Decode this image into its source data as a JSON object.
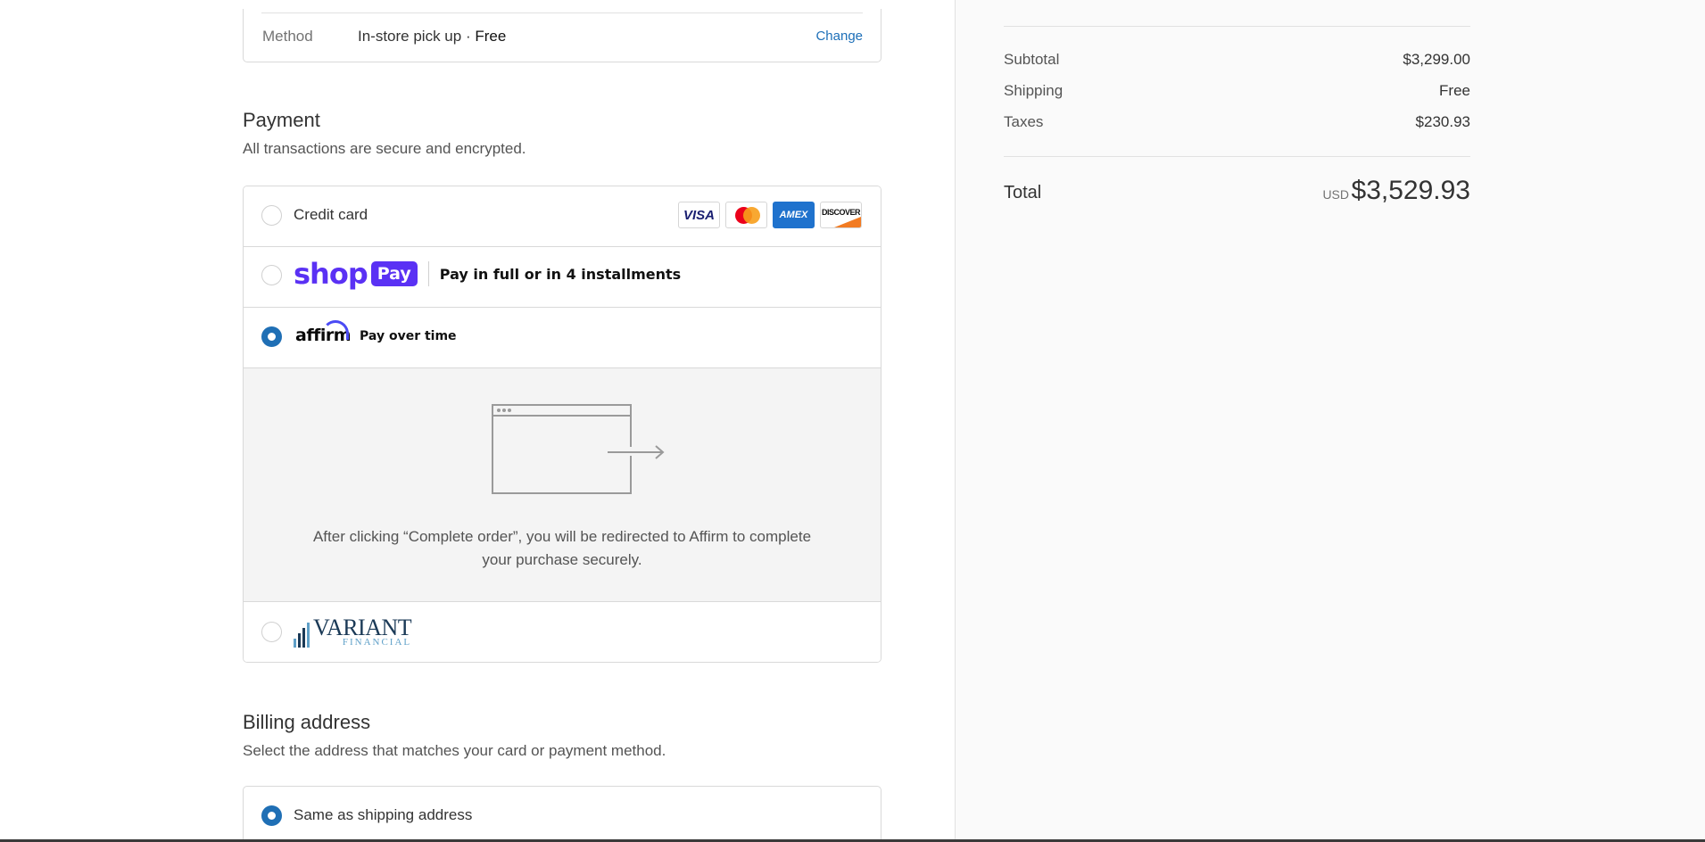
{
  "shipping_method": {
    "label": "Method",
    "value": "In-store pick up · ",
    "value_strong": "Free",
    "change_link": "Change"
  },
  "payment": {
    "title": "Payment",
    "subtitle": "All transactions are secure and encrypted.",
    "options": [
      {
        "label": "Credit card",
        "selected": false
      },
      {
        "label": "Shop Pay",
        "selected": false
      },
      {
        "label": "Affirm",
        "selected": true
      },
      {
        "label": "Variant Financial",
        "selected": false
      }
    ],
    "card_brands": [
      "VISA",
      "Mastercard",
      "AMEX",
      "DISCOVER"
    ],
    "shop_pay": {
      "logo_word": "shop",
      "logo_badge": "Pay",
      "tagline": "Pay in full or in 4 installments"
    },
    "affirm": {
      "logo_word": "affirm",
      "tagline": "Pay over time",
      "redirect_text": "After clicking “Complete order”, you will be redirected to Affirm to complete your purchase securely."
    },
    "variant": {
      "logo_main": "VARIANT",
      "logo_sub": "FINANCIAL"
    }
  },
  "billing": {
    "title": "Billing address",
    "subtitle": "Select the address that matches your card or payment method.",
    "options": [
      {
        "label": "Same as shipping address",
        "selected": true
      }
    ]
  },
  "summary": {
    "subtotal_label": "Subtotal",
    "subtotal_value": "$3,299.00",
    "shipping_label": "Shipping",
    "shipping_value": "Free",
    "taxes_label": "Taxes",
    "taxes_value": "$230.93",
    "total_label": "Total",
    "total_currency": "USD",
    "total_value": "$3,529.93"
  },
  "colors": {
    "accent": "#1f6fb5",
    "shop_pay": "#5a31f4",
    "affirm_arc": "#4a4af4"
  }
}
